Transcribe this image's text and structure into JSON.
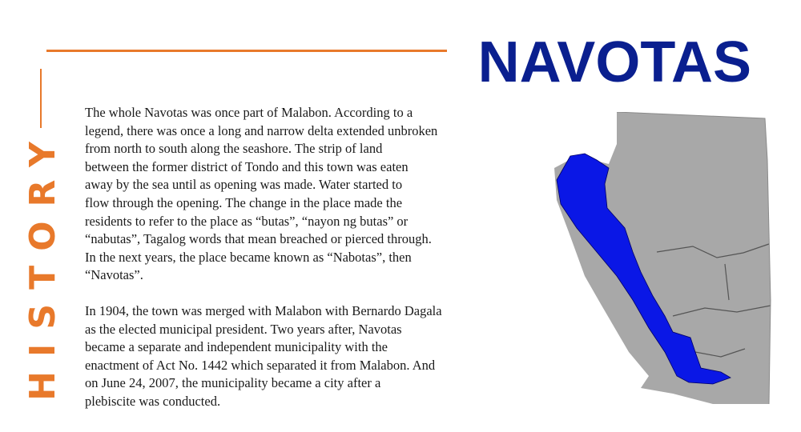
{
  "title": "NAVOTAS",
  "side_title": "HISTORY",
  "paragraphs": [
    "The whole Navotas was once part of Malabon. According to a\nlegend, there was once a long and narrow delta extended unbroken\nfrom north to south along the seashore. The strip of land\nbetween the former district of Tondo and this town was eaten\naway by the sea until as opening was made. Water started to\nflow through the opening. The change in the place made the\nresidents to refer to the place as “butas”, “nayon ng butas” or\n“nabutas”, Tagalog words that mean breached or pierced through.\nIn the next years, the place became known as “Nabotas”, then\n“Navotas”.",
    "In 1904, the town was merged with Malabon with Bernardo Dagala\nas the elected municipal president. Two years after, Navotas\nbecame a separate and independent municipality with the\nenactment of Act No. 1442 which separated it from Malabon. And\non June 24, 2007, the municipality became a city after a\nplebiscite was conducted."
  ],
  "colors": {
    "accent_orange": "#E8792B",
    "title_blue": "#0A1F8F",
    "map_highlight": "#0A17E6",
    "map_land": "#A8A8A8"
  },
  "map": {
    "icon": "navotas-location-map"
  }
}
